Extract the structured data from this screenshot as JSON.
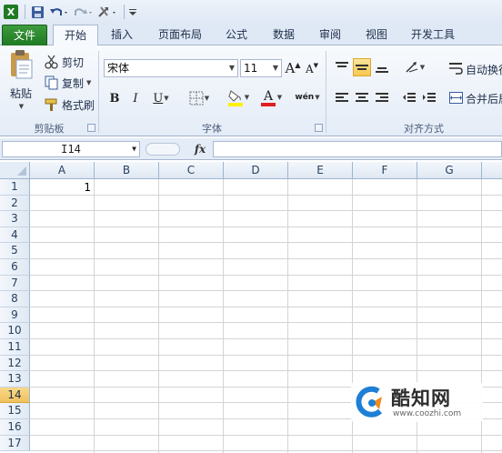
{
  "ribbon_tabs": [
    {
      "label": "文件"
    },
    {
      "label": "开始"
    },
    {
      "label": "插入"
    },
    {
      "label": "页面布局"
    },
    {
      "label": "公式"
    },
    {
      "label": "数据"
    },
    {
      "label": "审阅"
    },
    {
      "label": "视图"
    },
    {
      "label": "开发工具"
    }
  ],
  "clipboard": {
    "paste_label": "粘贴",
    "cut_label": "剪切",
    "copy_label": "复制",
    "format_painter_label": "格式刷",
    "group_label": "剪贴板"
  },
  "font": {
    "font_name": "宋体",
    "font_size": "11",
    "bold": "B",
    "italic": "I",
    "underline": "U",
    "grow": "A",
    "shrink": "A",
    "font_color_glyph": "A",
    "phonetic_glyph": "wén",
    "group_label": "字体"
  },
  "alignment": {
    "wrap_text_label": "自动换行",
    "merge_center_label": "合并后居中",
    "group_label": "对齐方式"
  },
  "formula_bar": {
    "name_box": "I14",
    "fx_label": "fx",
    "formula": ""
  },
  "sheet": {
    "columns": [
      "A",
      "B",
      "C",
      "D",
      "E",
      "F",
      "G"
    ],
    "rows": [
      "1",
      "2",
      "3",
      "4",
      "5",
      "6",
      "7",
      "8",
      "9",
      "10",
      "11",
      "12",
      "13",
      "14",
      "15",
      "16",
      "17"
    ],
    "selected_row": "14",
    "cell_A1": "1"
  },
  "watermark": {
    "title": "酷知网",
    "url": "www.coozhi.com"
  },
  "colors": {
    "file_tab": "#1f7a23",
    "accent_selected": "#f8c74d",
    "ribbon_bg": "#e4ecf7",
    "font_color_red": "#e02020",
    "fill_yellow": "#ffef00"
  }
}
